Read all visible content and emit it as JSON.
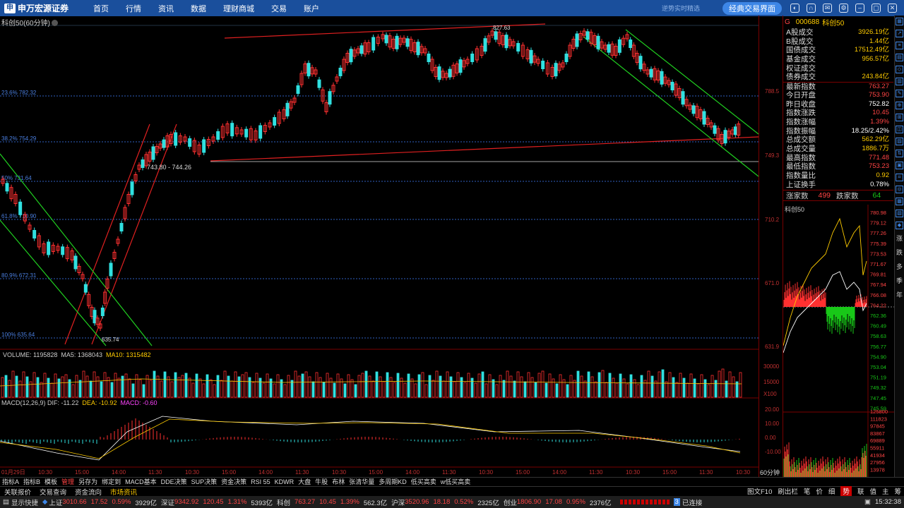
{
  "app": {
    "logo": "申万宏源证券",
    "nav": [
      "首页",
      "行情",
      "资讯",
      "数据",
      "理财商城",
      "交易",
      "账户"
    ],
    "promo": "逆势实时精选",
    "classic_btn": "经典交易界面"
  },
  "chart": {
    "title": "科创50(60分钟)",
    "fib": [
      "23.6% 782.32",
      "38.2% 754.29",
      "50% 731.64",
      "61.8% 710.90",
      "80.9% 672.31",
      "100% 635.64"
    ],
    "notes": [
      "827.63",
      "743.80 - 744.26",
      "635.74"
    ],
    "yaxis": [
      "788.5",
      "749.3",
      "710.2",
      "671.0",
      "631.9"
    ],
    "vol_title": {
      "name": "VOLUME: 1195828",
      "ma5": "MA5: 1368043",
      "ma10": "MA10: 1315482"
    },
    "vol_axis": [
      "30000",
      "15000",
      "X100"
    ],
    "macd_title": {
      "name": "MACD(12,26,9)",
      "dif": "DIF: -11.22",
      "dea": "DEA: -10.92",
      "macd": "MACD: -0.60"
    },
    "macd_axis": [
      "20.00",
      "10.00",
      "0.00",
      "-10.00"
    ],
    "xaxis": [
      "01月29日",
      "10:30",
      "15:00",
      "14:00",
      "11:30",
      "10:30",
      "15:00",
      "14:00",
      "11:30",
      "10:30",
      "15:00",
      "14:00",
      "11:30",
      "10:30",
      "15:00",
      "14:00",
      "11:30",
      "10:30",
      "15:00",
      "11:30",
      "10:30"
    ],
    "period": "60分钟"
  },
  "quote": {
    "flag": "G",
    "code": "000688",
    "name": "科创50",
    "rows": [
      [
        "A股成交",
        "3926.19亿",
        "yellow"
      ],
      [
        "B股成交",
        "1.44亿",
        "yellow"
      ],
      [
        "国债成交",
        "17512.49亿",
        "yellow"
      ],
      [
        "基金成交",
        "956.57亿",
        "yellow"
      ],
      [
        "权证成交",
        "",
        ""
      ],
      [
        "债券成交",
        "243.84亿",
        "yellow"
      ],
      [
        "最新指数",
        "763.27",
        "red"
      ],
      [
        "今日开盘",
        "753.90",
        "red"
      ],
      [
        "昨日收盘",
        "752.82",
        "w"
      ],
      [
        "指数涨跌",
        "10.45",
        "red"
      ],
      [
        "指数涨幅",
        "1.39%",
        "red"
      ],
      [
        "指数振幅",
        "18.25/2.42%",
        "w"
      ],
      [
        "总成交额",
        "562.29亿",
        "yellow"
      ],
      [
        "总成交量",
        "1886.7万",
        "yellow"
      ],
      [
        "最高指数",
        "771.48",
        "red"
      ],
      [
        "最低指数",
        "753.23",
        "red"
      ],
      [
        "指数量比",
        "0.92",
        "yellow"
      ],
      [
        "上证换手",
        "0.78%",
        "w"
      ]
    ],
    "up_label": "涨家数",
    "up": "499",
    "down_label": "跌家数",
    "down": "64",
    "mini_title": "科创50",
    "mini_axis": [
      "780.98",
      "779.12",
      "777.26",
      "775.39",
      "773.53",
      "771.67",
      "769.81",
      "767.94",
      "766.08",
      "764.22",
      "762.36",
      "760.49",
      "758.63",
      "756.77",
      "754.90",
      "753.04",
      "751.19",
      "749.32",
      "747.45",
      "745.59"
    ],
    "mini_vol": [
      "125800",
      "111823",
      "97845",
      "83867",
      "69889",
      "55911",
      "41934",
      "27956",
      "13978"
    ]
  },
  "sidebar": [
    "涨",
    "跌",
    "多",
    "季",
    "年"
  ],
  "toolbar": [
    "指标A",
    "指标B",
    "模板",
    "管理",
    "另存为",
    "绑定到",
    "MACD基本",
    "DDE决策",
    "SUP决策",
    "资金决策",
    "RSI 55",
    "KDWR",
    "大盘",
    "牛股",
    "布林",
    "张清华量",
    "多周期KD",
    "低买高卖",
    "w低买高卖"
  ],
  "toolbar_active": "管理",
  "toolbar2": [
    "关联报价",
    "交易查询",
    "资金流向",
    "市场资讯"
  ],
  "toolbar2_active": "市场资讯",
  "tb2right": [
    "图文F10",
    "刷出栏",
    "笔",
    "价",
    "细",
    "势",
    "联",
    "值",
    "主",
    "筹"
  ],
  "tb2right_active": "势",
  "status": {
    "show": "显示快捷",
    "sh": "上证",
    "sh_v": "3010.66",
    "sh_c": "17.52",
    "sh_p": "0.59%",
    "sh_a": "3929亿",
    "sz": "深证",
    "sz_v": "9342.92",
    "sz_c": "120.45",
    "sz_p": "1.31%",
    "sz_a": "5393亿",
    "kc": "科创",
    "kc_v": "763.27",
    "kc_c": "10.45",
    "kc_p": "1.39%",
    "kc_a": "562.3亿",
    "hs": "沪深",
    "hs_v": "3520.96",
    "hs_c": "18.18",
    "hs_p": "0.52%",
    "hs_a": "2325亿",
    "cy": "创业",
    "cy_v": "1806.90",
    "cy_c": "17.08",
    "cy_p": "0.95%",
    "cy_a": "2376亿",
    "conn": "已连接",
    "time": "15:32:38"
  }
}
